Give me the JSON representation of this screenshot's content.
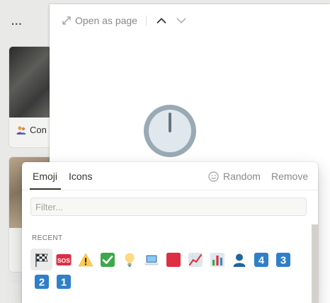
{
  "background": {
    "menu_dots": "...",
    "card_caption": "Con"
  },
  "peek": {
    "open_as_page": "Open as page",
    "icons": {
      "open": "expand-arrows-icon",
      "prev": "chevron-up-icon",
      "next": "chevron-down-icon",
      "page": "clock-twelve-emoji"
    }
  },
  "picker": {
    "tabs": [
      {
        "label": "Emoji",
        "active": true
      },
      {
        "label": "Icons",
        "active": false
      }
    ],
    "random_label": "Random",
    "remove_label": "Remove",
    "filter_placeholder": "Filter...",
    "filter_value": "",
    "recent_label": "RECENT",
    "recent_emoji": [
      "chequered-flag",
      "sos",
      "warning",
      "check-mark-button",
      "light-bulb",
      "laptop",
      "red-square",
      "chart-increasing",
      "bar-chart",
      "bust-in-silhouette",
      "keycap-4",
      "keycap-3",
      "keycap-2",
      "keycap-1"
    ],
    "sos_text": "SOS",
    "keycap_digits": [
      "4",
      "3",
      "2",
      "1"
    ]
  },
  "colors": {
    "accent_text": "#37352f",
    "muted_text": "#8a8985",
    "keycap_blue": "#2f7fc9",
    "red": "#dd2e44",
    "green": "#3da84a",
    "warning_yellow": "#ffcc4d"
  }
}
